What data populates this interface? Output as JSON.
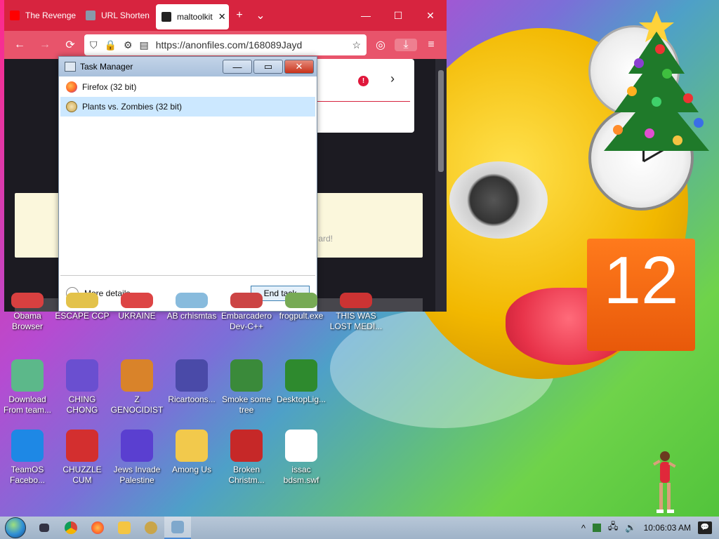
{
  "browser": {
    "tabs": [
      {
        "label": "The Revenge",
        "fav_color": "#ff0000"
      },
      {
        "label": "URL Shorten",
        "fav_color": "#8899aa"
      },
      {
        "label": "maltoolkit",
        "fav_color": "#222222",
        "close": "✕"
      }
    ],
    "new_tab": "+",
    "tab_list": "⌄",
    "win_min": "—",
    "win_max": "☐",
    "win_close": "✕",
    "nav": {
      "back": "←",
      "forward": "→",
      "reload": "⟳"
    },
    "url_icons": {
      "shield": "⛉",
      "lock": "🔒",
      "perm": "⚙",
      "reader": "▤"
    },
    "url": "https://anonfiles.com/168089Jayd",
    "bookmark": "☆",
    "pocket": "◎",
    "download": "⤓",
    "menu": "≡",
    "page_snippet": "ard!",
    "popup_warn": "!",
    "popup_arrow": "›"
  },
  "taskmgr": {
    "title": "Task Manager",
    "ctrl_min": "—",
    "ctrl_max": "▭",
    "ctrl_close": "✕",
    "processes": [
      {
        "name": "Firefox (32 bit)"
      },
      {
        "name": "Plants vs. Zombies (32 bit)",
        "selected": true
      }
    ],
    "more_details": "More details",
    "more_chevron": "⌄",
    "end_task": "End task"
  },
  "desktop_icons": [
    {
      "label": "Obama Browser",
      "color": "#d84040"
    },
    {
      "label": "ESCAPE CCP",
      "color": "#e3c24a"
    },
    {
      "label": "UKRAINE",
      "color": "#d44"
    },
    {
      "label": "AB crhismtas",
      "color": "#8bd"
    },
    {
      "label": "Embarcadero Dev-C++",
      "color": "#c44"
    },
    {
      "label": "frogpult.exe",
      "color": "#7a5"
    },
    {
      "label": "THIS WAS LOST MEDI...",
      "color": "#c33"
    },
    {
      "label": "Download From team...",
      "color": "#5cb88a"
    },
    {
      "label": "CHING CHONG",
      "color": "#6a4fd0"
    },
    {
      "label": "Z GENOCIDIST",
      "color": "#d9832a"
    },
    {
      "label": "Ricartoons...",
      "color": "#4a4aa8"
    },
    {
      "label": "Smoke some tree",
      "color": "#3a8a3a"
    },
    {
      "label": "DesktopLig...",
      "color": "#2e8a2e"
    },
    {
      "label": "TeamOS Facebo...",
      "color": "#1e88e5"
    },
    {
      "label": "CHUZZLE CUM",
      "color": "#d32f2f"
    },
    {
      "label": "Jews Invade Palestine",
      "color": "#5a3fd0"
    },
    {
      "label": "Among Us",
      "color": "#f2c94c"
    },
    {
      "label": "Broken Christm...",
      "color": "#c62828"
    },
    {
      "label": "issac bdsm.swf",
      "color": "#ffffff"
    }
  ],
  "calendar": {
    "day": "12"
  },
  "taskbar": {
    "items": [
      {
        "name": "task-view",
        "color": "#334"
      },
      {
        "name": "chrome",
        "color": "#e8a23a"
      },
      {
        "name": "firefox",
        "color": "#ff7139"
      },
      {
        "name": "file-explorer",
        "color": "#f4c542"
      },
      {
        "name": "plants-vs-zombies",
        "color": "#c9a54a"
      },
      {
        "name": "task-manager",
        "color": "#7fa8cc"
      }
    ],
    "tray_chevron": "^",
    "tray_network": "🖧",
    "tray_volume": "🔊",
    "clock": "10:06:03 AM",
    "notification": "💬"
  },
  "colors": {
    "firefox_tabbar": "#d7243f",
    "firefox_nav": "#e8546b",
    "selection": "#cce8ff"
  }
}
